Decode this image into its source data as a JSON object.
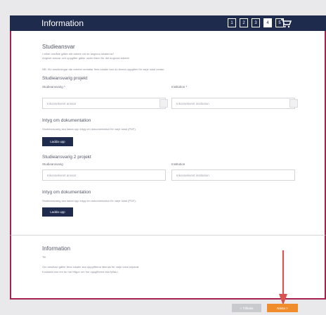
{
  "header": {
    "title": "Information",
    "steps": [
      "1",
      "2",
      "3",
      "4",
      "5"
    ],
    "active_step": "4",
    "cart_icon": "cart-icon"
  },
  "studieansvar": {
    "title": "Studieansvar",
    "intro_line1": "I vilket område gäller ditt arbete vid de angivna lokalerna?",
    "intro_line2": "Angivet ansvar och uppgifter gäller under tiden för det angivna arbetet",
    "note": "NB: Vid ansökningar där arbetet omfattar flera lokaler kan du lämna uppgifter för varje lokal nedan."
  },
  "project1": {
    "title": "Studieansvarig projekt",
    "studie_label": "Studieansvarig *",
    "studie_placeholder": "Inkonsekvent ansvar",
    "institution_label": "Institution *",
    "institution_placeholder": "Inkonsekvent institution",
    "doc_title": "Intyg om dokumentation",
    "doc_desc": "Studieansvarig ska ladda upp intyg om dokumentation för varje lokal (PDF).",
    "upload_label": "Ladda upp"
  },
  "project2": {
    "title": "Studieansvarig 2 projekt",
    "studie_label": "Studieansvarig",
    "studie_placeholder": "Inkonsekvent ansvar",
    "institution_label": "Institution",
    "institution_placeholder": "Inkonsekvent institution",
    "doc_title": "Intyg om dokumentation",
    "doc_desc": "Studieansvarig ska ladda upp intyg om dokumentation för varje lokal (PDF).",
    "upload_label": "Ladda upp"
  },
  "information": {
    "title": "Information",
    "subtitle": "Till",
    "line1": "Om ansökan gäller flera lokaler ska uppgifterna lämnas för varje lokal separat.",
    "line2": "Kontakta oss om du har frågor om hur uppgifterna ska fyllas i."
  },
  "nav": {
    "back_label": "< Tillbaka",
    "next_label": "Nästa >"
  },
  "colors": {
    "header_bg": "#1f2b4d",
    "panel_border": "#a8204e",
    "next_button": "#f08c2c",
    "arrow": "#d9534f"
  }
}
